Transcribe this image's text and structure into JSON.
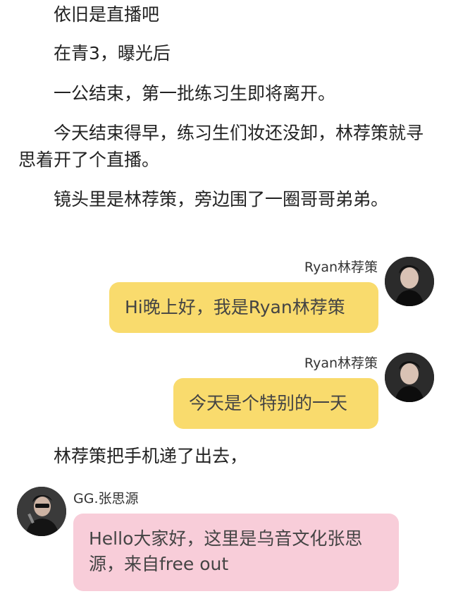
{
  "paragraphs": [
    "依旧是直播吧",
    "在青3，曝光后",
    "一公结束，第一批练习生即将离开。",
    "今天结束得早，练习生们妆还没卸，林荐策就寻思着开了个直播。",
    "镜头里是林荐策，旁边围了一圈哥哥弟弟。",
    "林荐策把手机递了出去，"
  ],
  "messages": [
    {
      "sender": "Ryan林荐策",
      "text": "Hi晚上好，我是Ryan林荐策",
      "side": "right",
      "color": "#f9db6d",
      "avatar_icon": "user-avatar-icon"
    },
    {
      "sender": "Ryan林荐策",
      "text": "今天是个特别的一天",
      "side": "right",
      "color": "#f9db6d",
      "avatar_icon": "user-avatar-icon"
    },
    {
      "sender": "GG.张思源",
      "text": "Hello大家好，这里是乌音文化张思源，来自free out",
      "side": "left",
      "color": "#f8cdd9",
      "avatar_icon": "singer-avatar-icon"
    }
  ]
}
